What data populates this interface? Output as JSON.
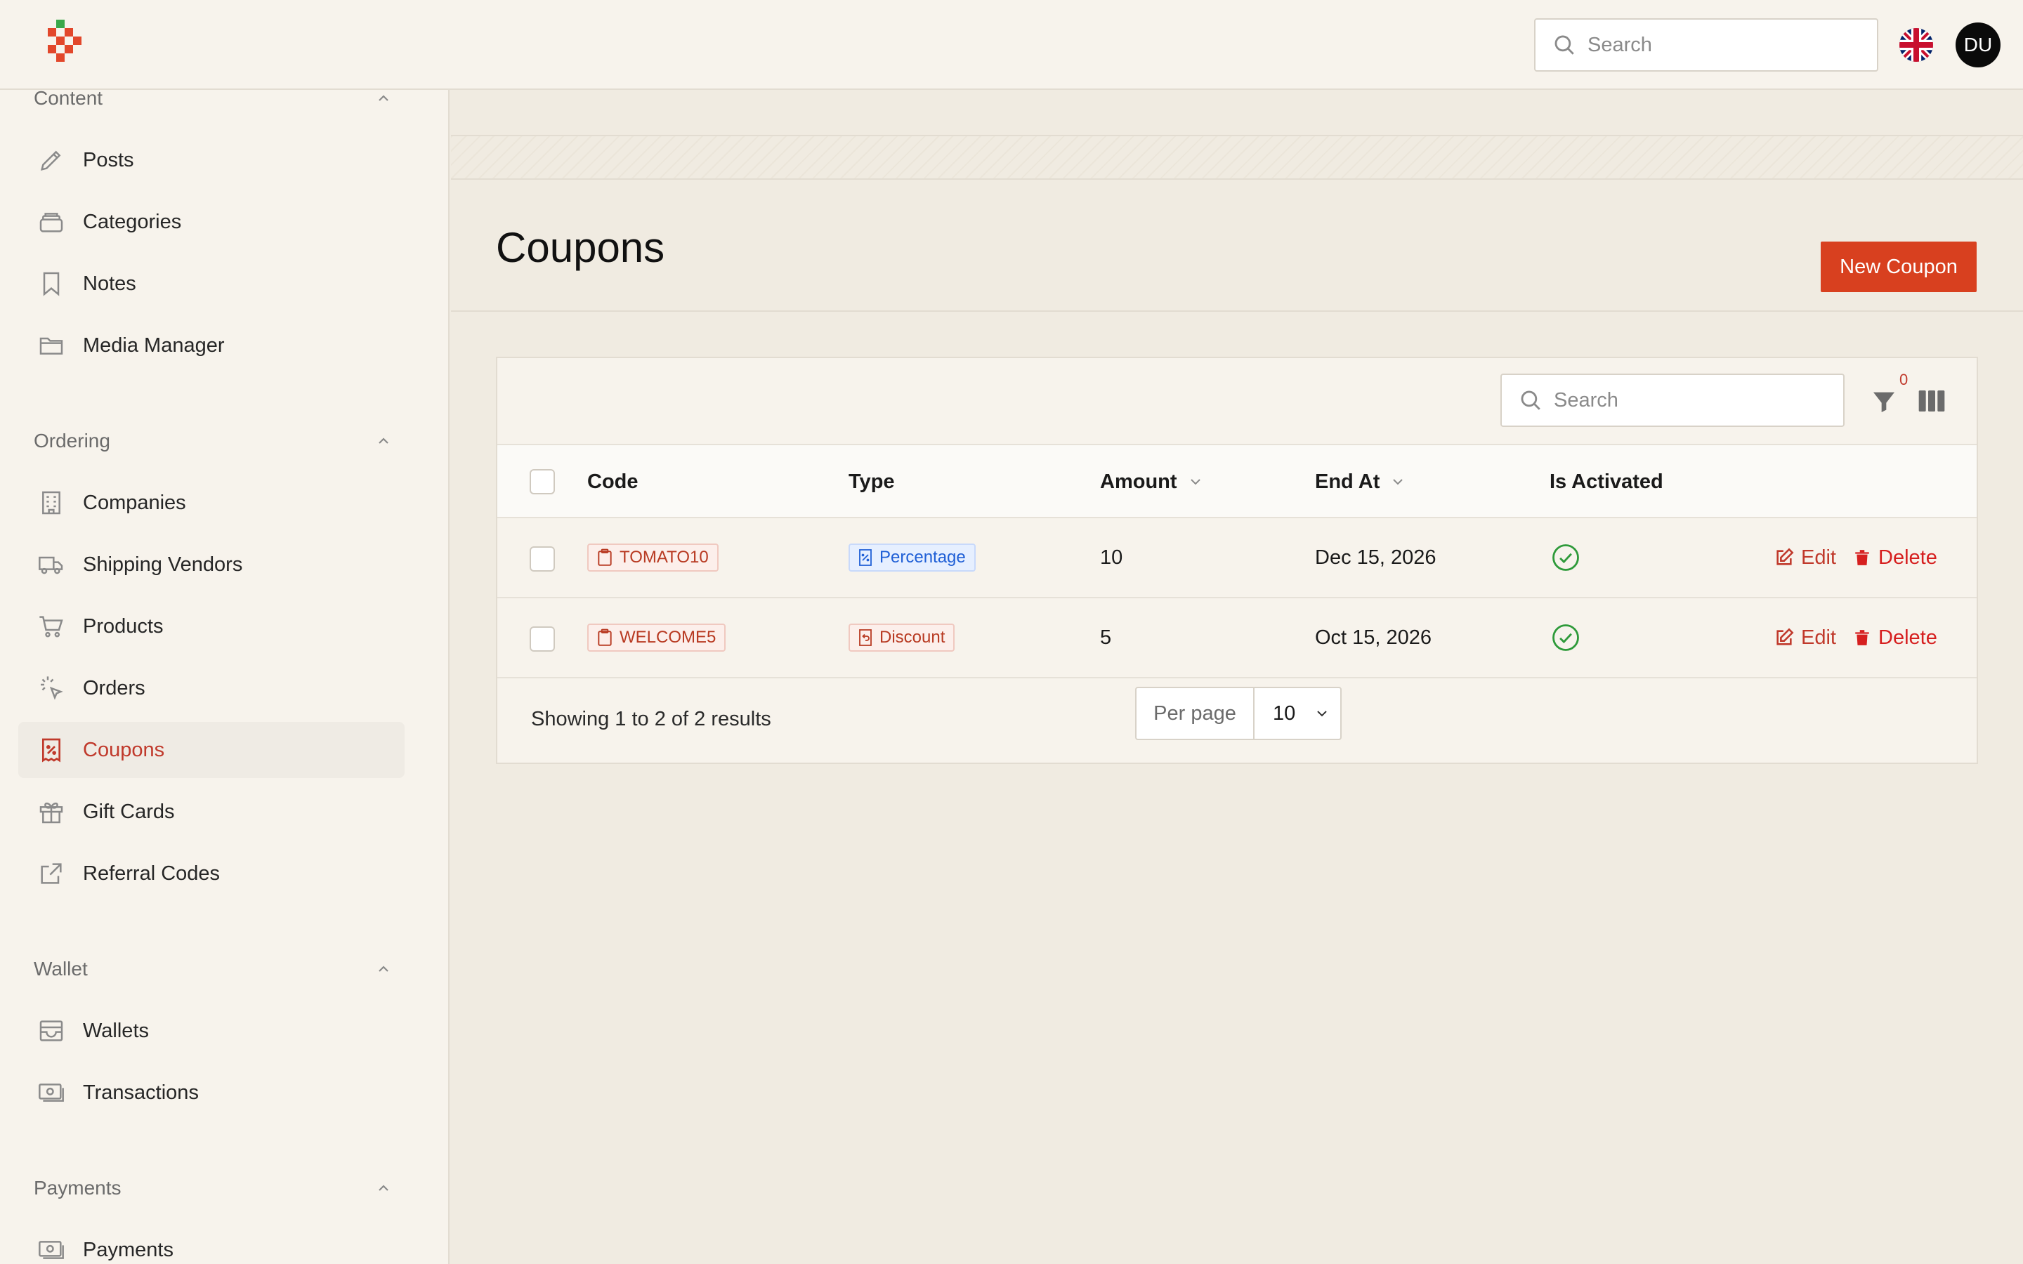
{
  "topbar": {
    "search_placeholder": "Search",
    "avatar_initials": "DU"
  },
  "sidebar": {
    "groups": [
      {
        "label": "Content",
        "items": [
          {
            "label": "Posts",
            "icon": "pencil-icon"
          },
          {
            "label": "Categories",
            "icon": "stack-icon"
          },
          {
            "label": "Notes",
            "icon": "bookmark-icon"
          },
          {
            "label": "Media Manager",
            "icon": "folder-icon"
          }
        ]
      },
      {
        "label": "Ordering",
        "items": [
          {
            "label": "Companies",
            "icon": "building-icon"
          },
          {
            "label": "Shipping Vendors",
            "icon": "truck-icon"
          },
          {
            "label": "Products",
            "icon": "cart-icon"
          },
          {
            "label": "Orders",
            "icon": "cursor-click-icon"
          },
          {
            "label": "Coupons",
            "icon": "receipt-percent-icon",
            "active": true
          },
          {
            "label": "Gift Cards",
            "icon": "gift-icon"
          },
          {
            "label": "Referral Codes",
            "icon": "external-link-icon"
          }
        ]
      },
      {
        "label": "Wallet",
        "items": [
          {
            "label": "Wallets",
            "icon": "inbox-icon"
          },
          {
            "label": "Transactions",
            "icon": "banknotes-icon"
          }
        ]
      },
      {
        "label": "Payments",
        "items": [
          {
            "label": "Payments",
            "icon": "banknotes-icon"
          }
        ]
      }
    ]
  },
  "page": {
    "title": "Coupons",
    "new_button": "New Coupon"
  },
  "table": {
    "search_placeholder": "Search",
    "filter_count": "0",
    "columns": {
      "code": "Code",
      "type": "Type",
      "amount": "Amount",
      "end_at": "End At",
      "is_activated": "Is Activated"
    },
    "rows": [
      {
        "code": "TOMATO10",
        "type": "Percentage",
        "amount": "10",
        "end_at": "Dec 15, 2026",
        "activated": true
      },
      {
        "code": "WELCOME5",
        "type": "Discount",
        "amount": "5",
        "end_at": "Oct 15, 2026",
        "activated": true
      }
    ],
    "actions": {
      "edit": "Edit",
      "delete": "Delete"
    },
    "footer": {
      "showing": "Showing 1 to 2 of 2 results",
      "per_page_label": "Per page",
      "per_page_value": "10"
    }
  },
  "colors": {
    "accent": "#d8401f",
    "active_text": "#c0392b",
    "success": "#2e9a3a",
    "percentage_badge": "#1f5fd6"
  }
}
